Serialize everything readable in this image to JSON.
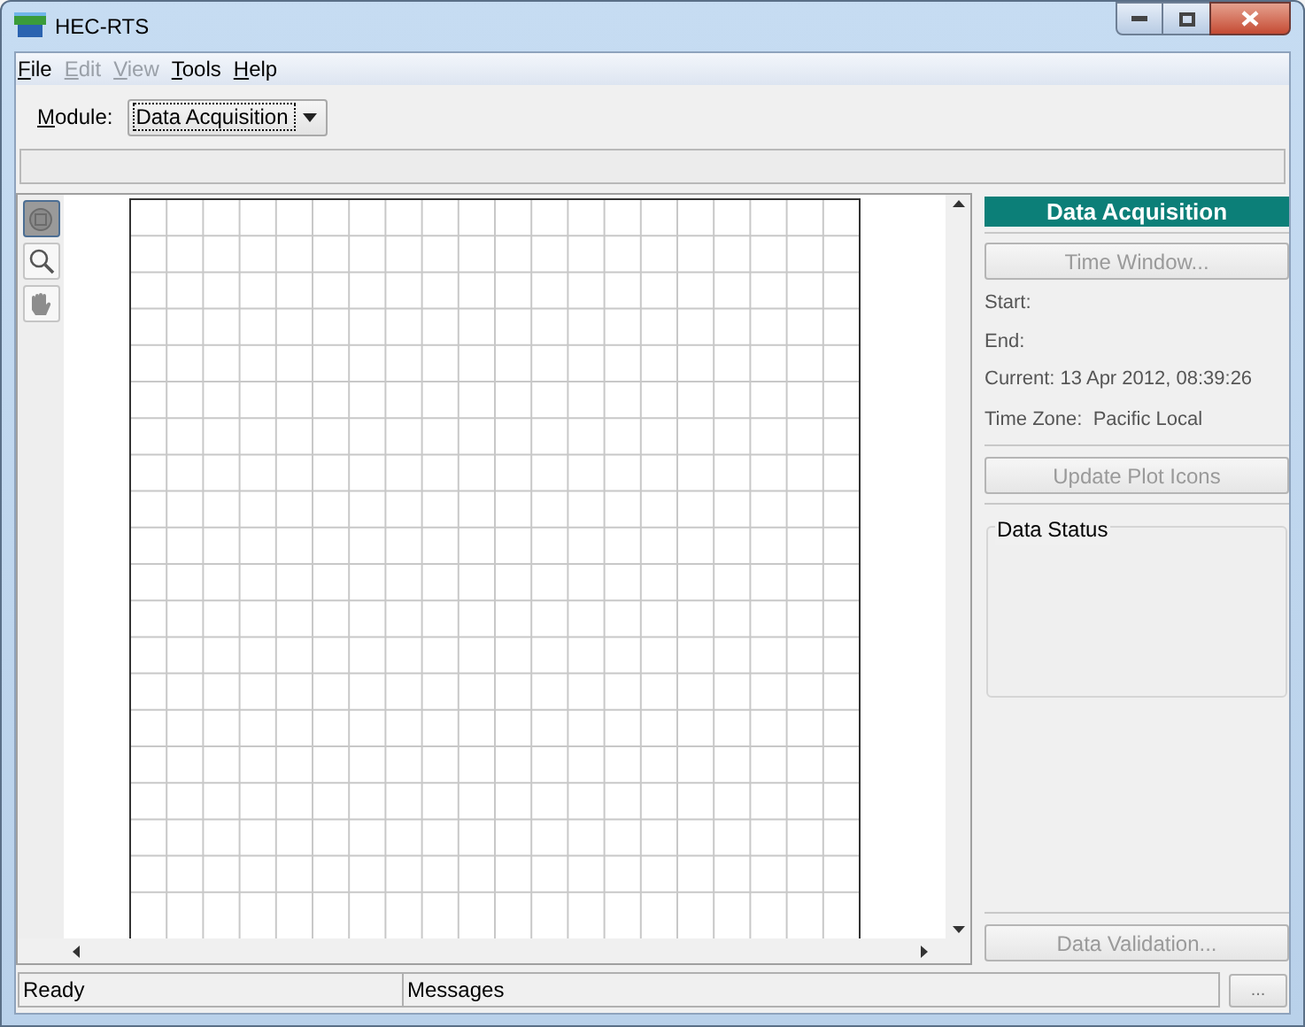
{
  "window": {
    "title": "HEC-RTS"
  },
  "menu": [
    {
      "label": "File",
      "disabled": false
    },
    {
      "label": "Edit",
      "disabled": true
    },
    {
      "label": "View",
      "disabled": true
    },
    {
      "label": "Tools",
      "disabled": false
    },
    {
      "label": "Help",
      "disabled": false
    }
  ],
  "module": {
    "label": "Module:",
    "value": "Data Acquisition"
  },
  "tools": [
    {
      "kind": "select",
      "selected": true
    },
    {
      "kind": "zoom",
      "selected": false
    },
    {
      "kind": "pan",
      "selected": false
    }
  ],
  "panel": {
    "title": "Data Acquisition",
    "time_window_button": {
      "label": "Time Window...",
      "disabled": true
    },
    "start": "Start:",
    "end": "End:",
    "current": "Current: 13 Apr 2012, 08:39:26",
    "time_zone": "Time Zone:  Pacific Local",
    "update_button": {
      "label": "Update Plot Icons",
      "disabled": true
    },
    "data_status": "Data Status",
    "validation_button": {
      "label": "Data Validation...",
      "disabled": true
    }
  },
  "status_bar": {
    "status": "Ready",
    "messages": "Messages",
    "more_button": "..."
  }
}
